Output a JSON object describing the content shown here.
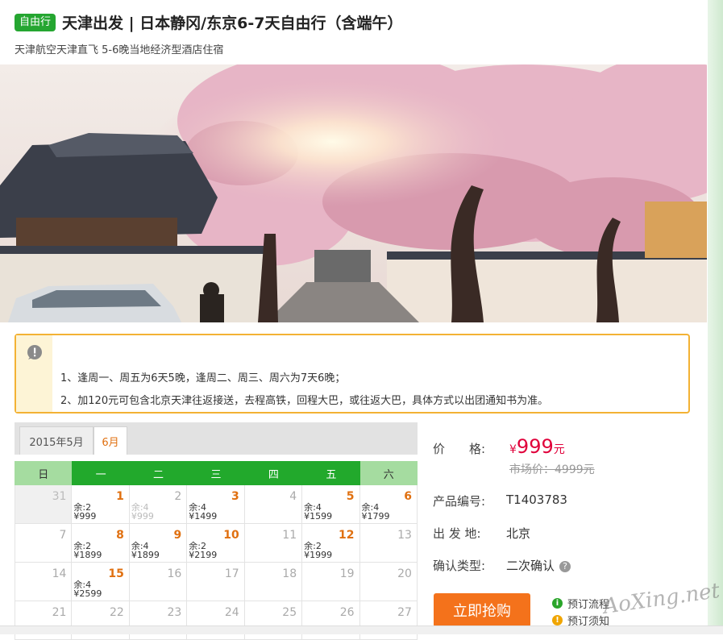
{
  "header": {
    "badge": "自由行",
    "title": "天津出发 | 日本静冈/东京6-7天自由行（含端午）",
    "subtitle": "天津航空天津直飞 5-6晚当地经济型酒店住宿"
  },
  "notice": {
    "line1": "1、逢周一、周五为6天5晚，逢周二、周三、周六为7天6晚；",
    "line2": "2、加120元可包含北京天津往返接送，去程高铁，回程大巴，或往返大巴，具体方式以出团通知书为准。"
  },
  "calendar": {
    "tabs": [
      "2015年5月",
      "6月"
    ],
    "active_tab": 1,
    "weekdays": [
      "日",
      "一",
      "二",
      "三",
      "四",
      "五",
      "六"
    ],
    "rows": [
      [
        {
          "day": "31",
          "state": "prev"
        },
        {
          "day": "1",
          "state": "avail",
          "remain": "余:2",
          "price": "¥999"
        },
        {
          "day": "2",
          "state": "faded",
          "remain": "余:4",
          "price": "¥999"
        },
        {
          "day": "3",
          "state": "avail",
          "remain": "余:4",
          "price": "¥1499"
        },
        {
          "day": "4",
          "state": "none"
        },
        {
          "day": "5",
          "state": "avail",
          "remain": "余:4",
          "price": "¥1599"
        },
        {
          "day": "6",
          "state": "avail",
          "remain": "余:4",
          "price": "¥1799"
        }
      ],
      [
        {
          "day": "7",
          "state": "none"
        },
        {
          "day": "8",
          "state": "avail",
          "remain": "余:2",
          "price": "¥1899"
        },
        {
          "day": "9",
          "state": "avail",
          "remain": "余:4",
          "price": "¥1899"
        },
        {
          "day": "10",
          "state": "avail",
          "remain": "余:2",
          "price": "¥2199"
        },
        {
          "day": "11",
          "state": "none"
        },
        {
          "day": "12",
          "state": "avail",
          "remain": "余:2",
          "price": "¥1999"
        },
        {
          "day": "13",
          "state": "none"
        }
      ],
      [
        {
          "day": "14",
          "state": "none"
        },
        {
          "day": "15",
          "state": "avail",
          "remain": "余:4",
          "price": "¥2599"
        },
        {
          "day": "16",
          "state": "none"
        },
        {
          "day": "17",
          "state": "none"
        },
        {
          "day": "18",
          "state": "none"
        },
        {
          "day": "19",
          "state": "none"
        },
        {
          "day": "20",
          "state": "none"
        }
      ],
      [
        {
          "day": "21",
          "state": "none"
        },
        {
          "day": "22",
          "state": "none"
        },
        {
          "day": "23",
          "state": "none"
        },
        {
          "day": "24",
          "state": "none"
        },
        {
          "day": "25",
          "state": "none"
        },
        {
          "day": "26",
          "state": "none"
        },
        {
          "day": "27",
          "state": "none"
        }
      ]
    ]
  },
  "product": {
    "price_label": "价　　格:",
    "price_currency": "¥",
    "price_value": "999",
    "price_unit": "元",
    "market_price": "市场价：4999元",
    "code_label": "产品编号:",
    "code_value": "T1403783",
    "depart_label": "出 发 地:",
    "depart_value": "北京",
    "confirm_label": "确认类型:",
    "confirm_value": "二次确认",
    "help_icon": "?",
    "buy_label": "立即抢购",
    "link_process": "预订流程",
    "link_notice": "预订须知"
  },
  "watermark": "AoXing.net",
  "colors": {
    "green": "#22a92c",
    "orange": "#f4721b",
    "price_red": "#e0003a",
    "notice_border": "#f3b234"
  }
}
